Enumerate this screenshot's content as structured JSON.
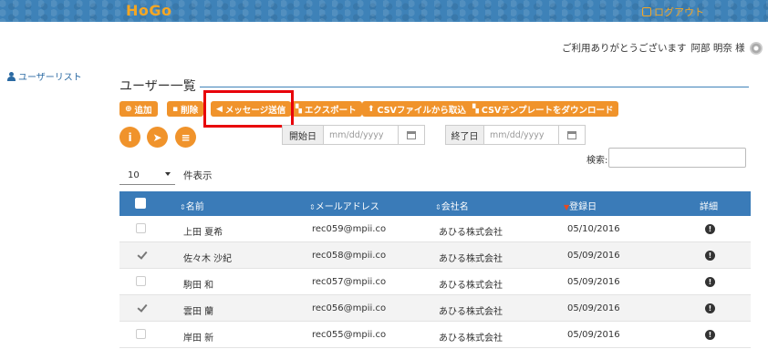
{
  "header": {
    "logo": "HoGo",
    "logout_label": "ログアウト"
  },
  "user": {
    "greeting": "ご利用ありがとうございます",
    "name": "阿部 明奈 様"
  },
  "sidebar": {
    "items": [
      {
        "label": "ユーザーリスト"
      }
    ]
  },
  "main": {
    "title": "ユーザー一覧",
    "toolbar": {
      "add": "追加",
      "delete": "削除",
      "send_message": "メッセージ送信",
      "export": "エクスポート",
      "csv_import": "CSVファイルから取込",
      "csv_template": "CSVテンプレートをダウンロード"
    },
    "circle_buttons": [
      {
        "icon": "info-icon",
        "glyph": "i"
      },
      {
        "icon": "send-icon",
        "glyph": "➤"
      },
      {
        "icon": "document-icon",
        "glyph": "≡"
      }
    ],
    "date_filter": {
      "start_label": "開始日",
      "start_placeholder": "mm/dd/yyyy",
      "end_label": "終了日",
      "end_placeholder": "mm/dd/yyyy"
    },
    "search": {
      "label": "検索:",
      "value": ""
    },
    "page_length": {
      "value": "10",
      "label": "件表示"
    }
  },
  "table": {
    "columns": [
      "名前",
      "メールアドレス",
      "会社名",
      "登録日",
      "詳細"
    ],
    "rows": [
      {
        "checked": false,
        "name": "上田 夏希",
        "email": "rec059@mpii.co",
        "company": "あひる株式会社",
        "date": "05/10/2016"
      },
      {
        "checked": true,
        "name": "佐々木 沙紀",
        "email": "rec058@mpii.co",
        "company": "あひる株式会社",
        "date": "05/09/2016"
      },
      {
        "checked": false,
        "name": "駒田 和",
        "email": "rec057@mpii.co",
        "company": "あひる株式会社",
        "date": "05/09/2016"
      },
      {
        "checked": true,
        "name": "雲田 蘭",
        "email": "rec056@mpii.co",
        "company": "あひる株式会社",
        "date": "05/09/2016"
      },
      {
        "checked": false,
        "name": "岸田 新",
        "email": "rec055@mpii.co",
        "company": "あひる株式会社",
        "date": "05/09/2016"
      }
    ]
  },
  "colors": {
    "accent": "#f0932b",
    "header_blue": "#3a7bb8",
    "highlight_red": "#e8000a"
  }
}
